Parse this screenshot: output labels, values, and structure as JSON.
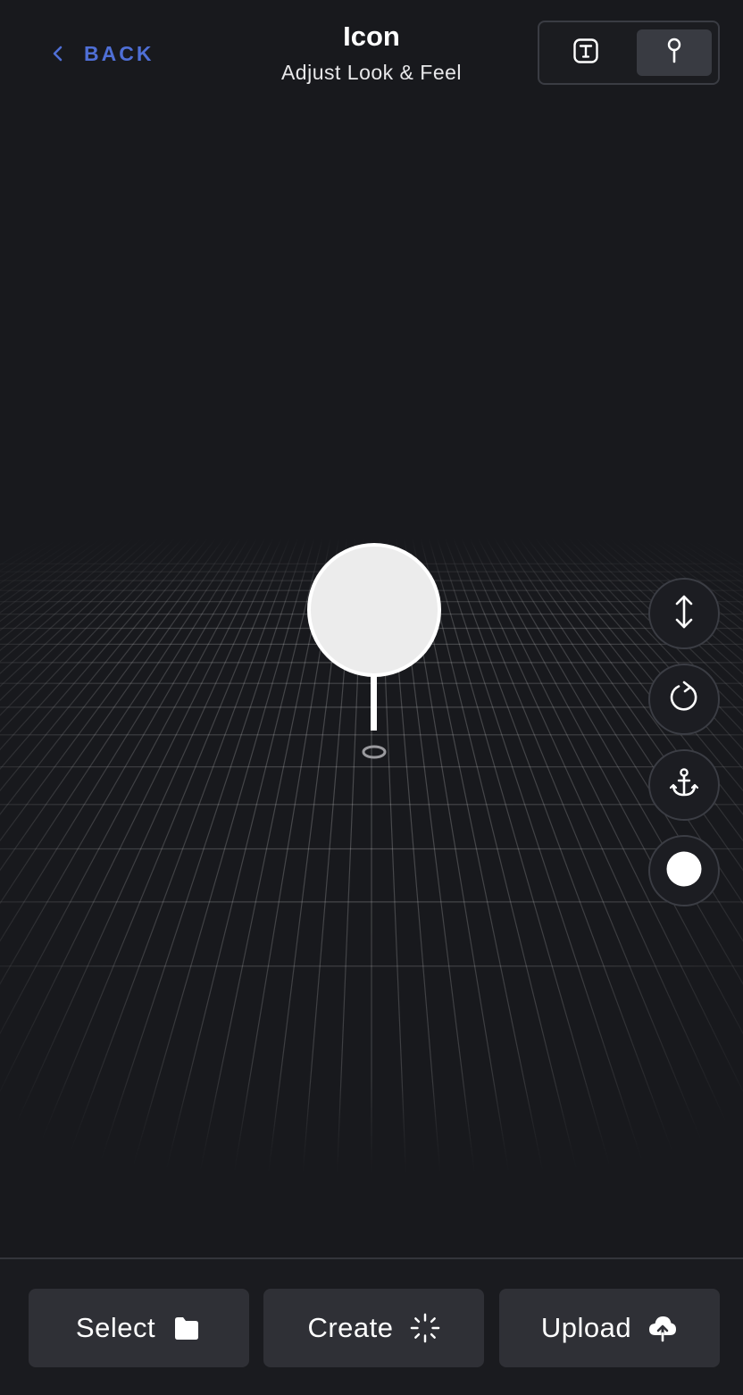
{
  "header": {
    "back_label": "BACK",
    "title": "Icon",
    "subtitle": "Adjust Look & Feel",
    "modes": [
      {
        "name": "text-mode",
        "icon": "text-box-icon",
        "selected": false
      },
      {
        "name": "pin-mode",
        "icon": "map-pin-icon",
        "selected": true
      }
    ]
  },
  "viewport": {
    "marker": {
      "shape": "pin",
      "head_color": "#ececec",
      "outline_color": "#ffffff"
    },
    "grid_color": "#ffffff"
  },
  "tools": [
    {
      "name": "height-tool",
      "icon": "vertical-arrows-icon"
    },
    {
      "name": "rotate-tool",
      "icon": "rotate-icon"
    },
    {
      "name": "anchor-tool",
      "icon": "anchor-icon"
    },
    {
      "name": "color-tool",
      "icon": "white-circle-icon",
      "color": "#ffffff"
    }
  ],
  "actions": [
    {
      "label": "Select",
      "icon": "folder-icon"
    },
    {
      "label": "Create",
      "icon": "sparkle-loader-icon"
    },
    {
      "label": "Upload",
      "icon": "cloud-upload-icon"
    }
  ],
  "colors": {
    "background": "#18191d",
    "accent": "#4f6fd6",
    "button": "#2f3036",
    "text": "#ffffff"
  }
}
